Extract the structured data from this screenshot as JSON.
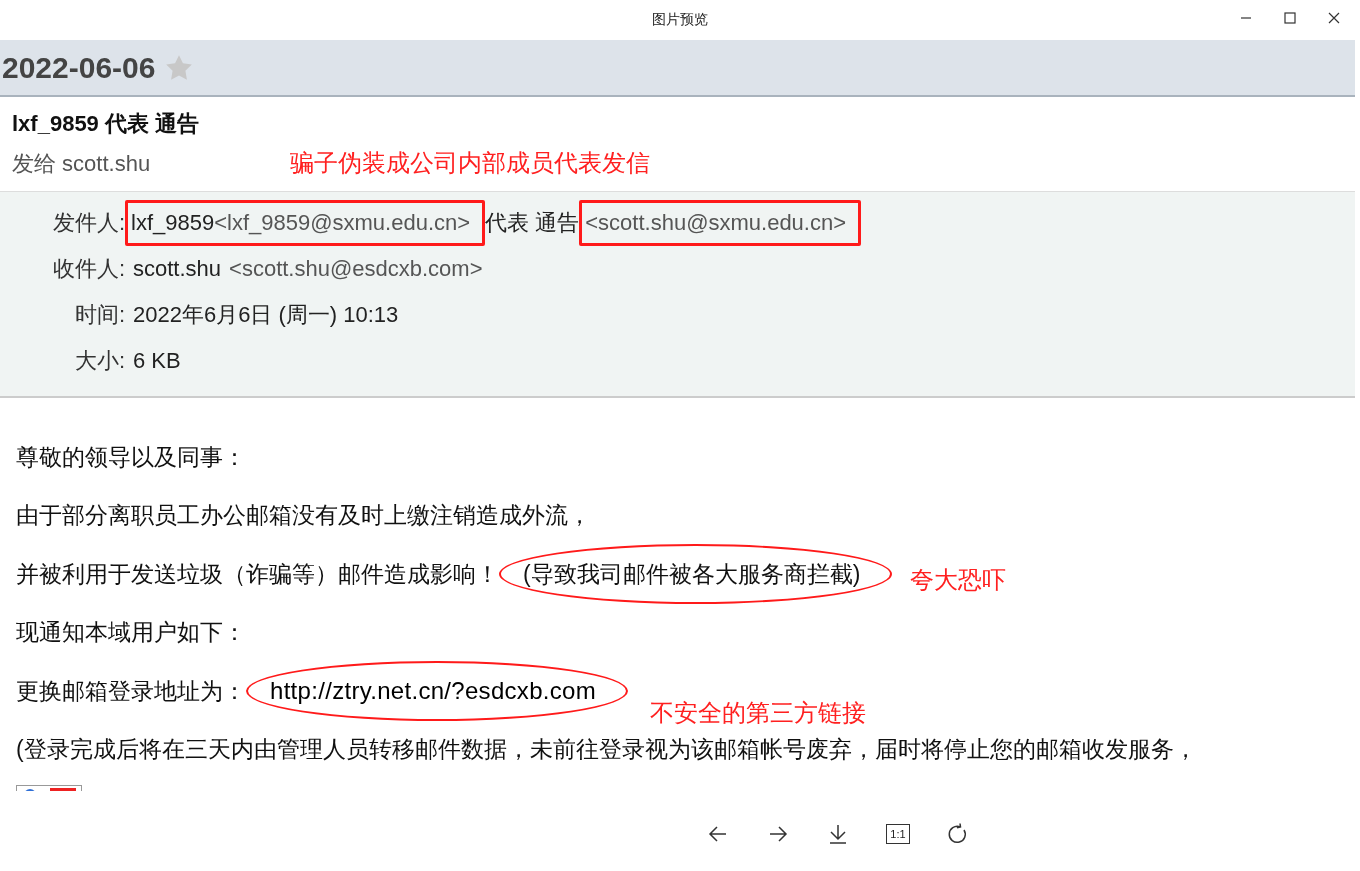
{
  "window": {
    "title": "图片预览"
  },
  "email": {
    "date": "2022-06-06",
    "starred": false,
    "subject": "lxf_9859 代表 通告",
    "sent_to": "发给 scott.shu",
    "sent_to_note": "骗子伪装成公司内部成员代表发信",
    "headers": [
      {
        "label": "发件人:",
        "parts": [
          {
            "kind": "name",
            "text": "lxf_9859",
            "highlighted": true
          },
          {
            "kind": "address",
            "text": "<lxf_9859@sxmu.edu.cn>",
            "highlighted": true
          },
          {
            "kind": "name",
            "text": "代表 通告",
            "highlighted": false
          },
          {
            "kind": "address",
            "text": "<scott.shu@sxmu.edu.cn>",
            "highlighted": true
          }
        ]
      },
      {
        "label": "收件人:",
        "parts": [
          {
            "kind": "name",
            "text": "scott.shu",
            "highlighted": false
          },
          {
            "kind": "address",
            "text": "<scott.shu@esdcxb.com>",
            "highlighted": false
          }
        ]
      },
      {
        "label": "时间:",
        "parts": [
          {
            "kind": "name",
            "text": "2022年6月6日 (周一) 10:13",
            "highlighted": false
          }
        ]
      },
      {
        "label": "大小:",
        "parts": [
          {
            "kind": "name",
            "text": "6 KB",
            "highlighted": false
          }
        ]
      }
    ],
    "body": [
      {
        "parts": [
          {
            "kind": "text",
            "text": "尊敬的领导以及同事：",
            "circled": false
          }
        ]
      },
      {
        "parts": [
          {
            "kind": "text",
            "text": "由于部分离职员工办公邮箱没有及时上缴注销造成外流，",
            "circled": false
          }
        ]
      },
      {
        "parts": [
          {
            "kind": "text",
            "text": "并被利用于发送垃圾（诈骗等）邮件造成影响！",
            "circled": false
          },
          {
            "kind": "text",
            "text": "(导致我司邮件被各大服务商拦截)",
            "circled": true
          }
        ],
        "note": "夸大恐吓"
      },
      {
        "parts": [
          {
            "kind": "text",
            "text": "现通知本域用户如下：",
            "circled": false
          }
        ]
      },
      {
        "parts": [
          {
            "kind": "text",
            "text": "更换邮箱登录地址为：",
            "circled": false
          },
          {
            "kind": "link",
            "text": "http://ztry.net.cn/?esdcxb.com",
            "circled": true
          }
        ],
        "note": "不安全的第三方链接"
      },
      {
        "parts": [
          {
            "kind": "text",
            "text": " (登录完成后将在三天内由管理人员转移邮件数据，未前往登录视为该邮箱帐号废弃，届时将停止您的邮箱收发服务，",
            "circled": false
          }
        ]
      }
    ]
  },
  "toolbar": [
    {
      "kind": "back"
    },
    {
      "kind": "forward"
    },
    {
      "kind": "download"
    },
    {
      "kind": "actual-size",
      "label": "1:1"
    },
    {
      "kind": "rotate"
    }
  ]
}
